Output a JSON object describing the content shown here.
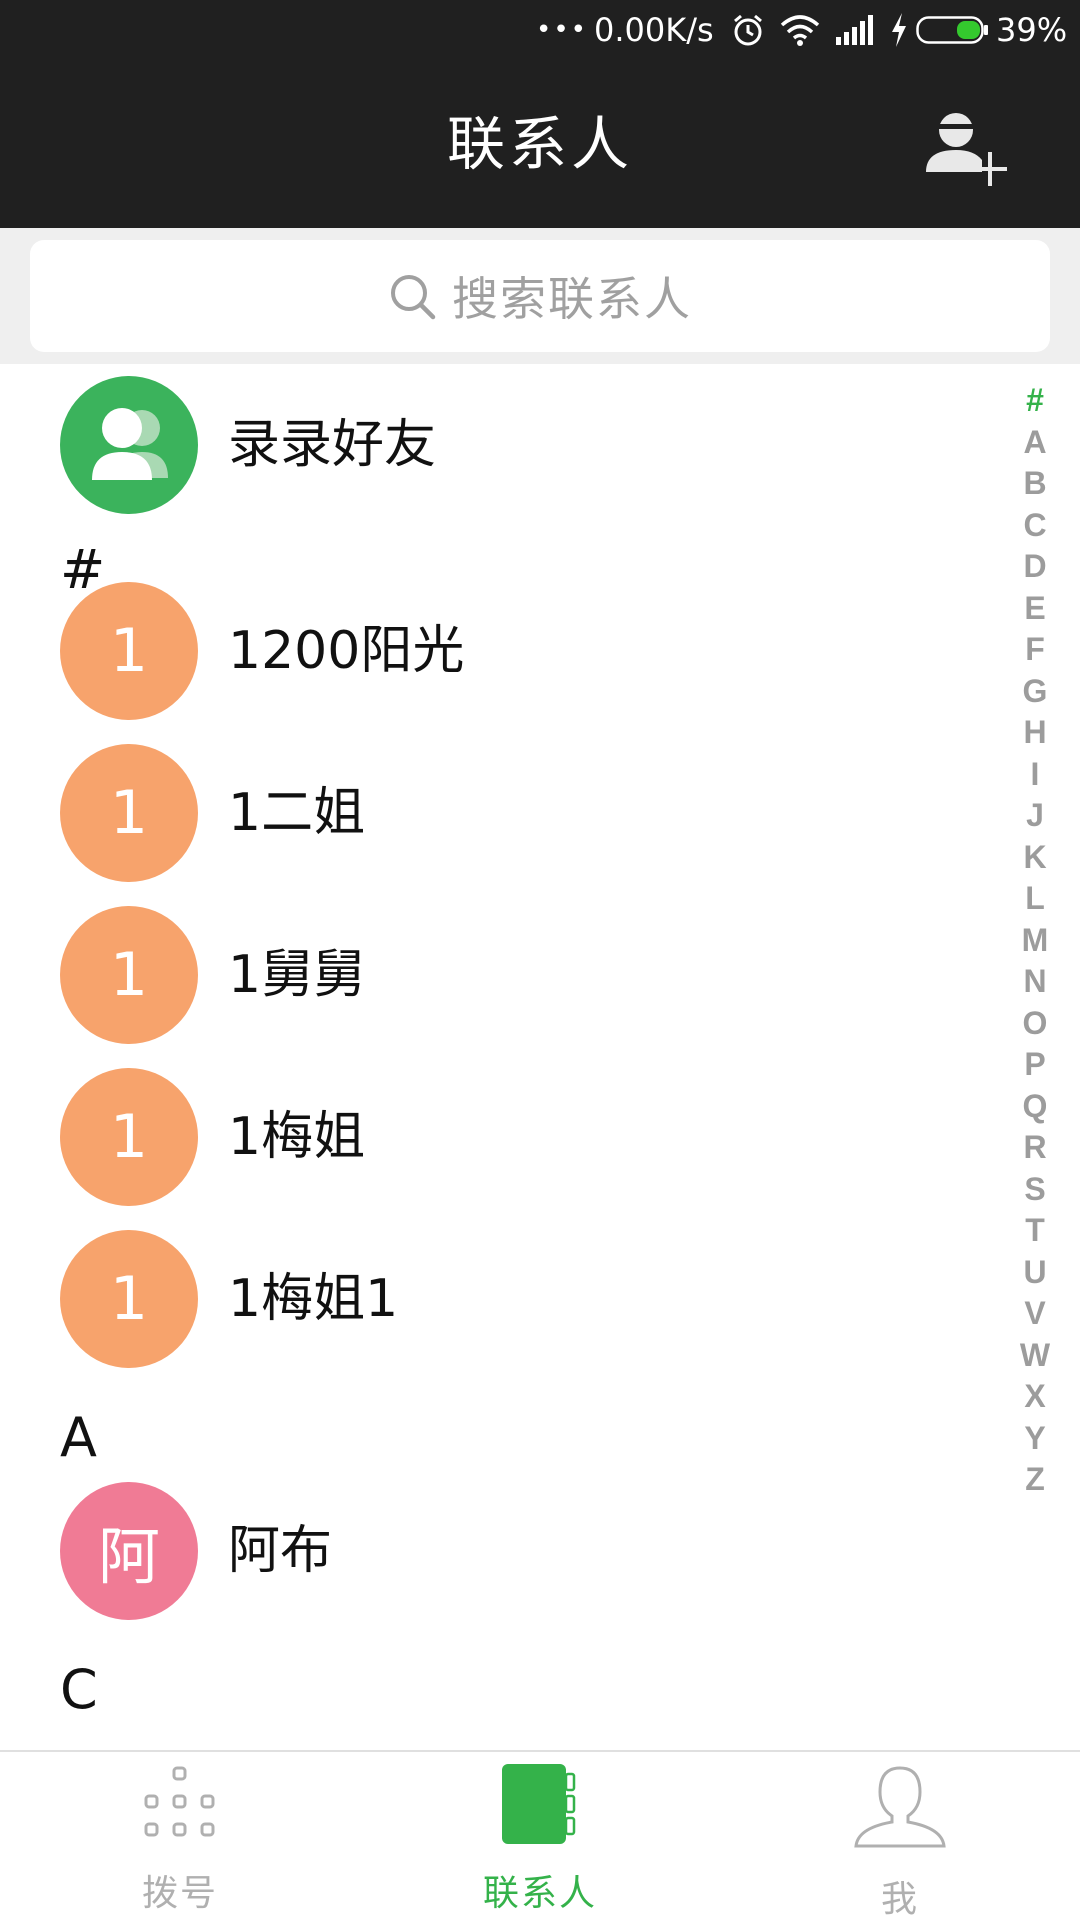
{
  "status_bar": {
    "dots": "•••",
    "net_speed": "0.00K/s",
    "battery_percent": "39%",
    "battery_level": 0.39,
    "icons": [
      "more-dots-icon",
      "alarm-icon",
      "wifi-icon",
      "signal-icon",
      "charging-icon",
      "battery-icon"
    ]
  },
  "header": {
    "title": "联系人",
    "add_icon": "add-contact-icon"
  },
  "search": {
    "placeholder": "搜索联系人",
    "icon": "search-icon"
  },
  "friends_entry": {
    "label": "录录好友",
    "icon": "friends-icon",
    "color": "#3bb35c"
  },
  "sections": [
    {
      "letter": "#",
      "contacts": [
        {
          "initial": "1",
          "name": "1200阳光",
          "color": "#f7a36c"
        },
        {
          "initial": "1",
          "name": "1二姐",
          "color": "#f7a36c"
        },
        {
          "initial": "1",
          "name": "1舅舅",
          "color": "#f7a36c"
        },
        {
          "initial": "1",
          "name": "1梅姐",
          "color": "#f7a36c"
        },
        {
          "initial": "1",
          "name": "1梅姐1",
          "color": "#f7a36c"
        }
      ]
    },
    {
      "letter": "A",
      "contacts": [
        {
          "initial": "阿",
          "name": "阿布",
          "color": "#f07b95"
        }
      ]
    },
    {
      "letter": "C",
      "contacts": []
    }
  ],
  "index_bar": {
    "letters": [
      "#",
      "A",
      "B",
      "C",
      "D",
      "E",
      "F",
      "G",
      "H",
      "I",
      "J",
      "K",
      "L",
      "M",
      "N",
      "O",
      "P",
      "Q",
      "R",
      "S",
      "T",
      "U",
      "V",
      "W",
      "X",
      "Y",
      "Z"
    ],
    "active": "#",
    "active_color": "#34b24a"
  },
  "tabs": [
    {
      "label": "拨号",
      "icon": "dialpad-icon",
      "active": false
    },
    {
      "label": "联系人",
      "icon": "contacts-book-icon",
      "active": true
    },
    {
      "label": "我",
      "icon": "profile-icon",
      "active": false
    }
  ],
  "colors": {
    "header_bg": "#202020",
    "accent": "#34b24a",
    "search_bg": "#efefef"
  }
}
